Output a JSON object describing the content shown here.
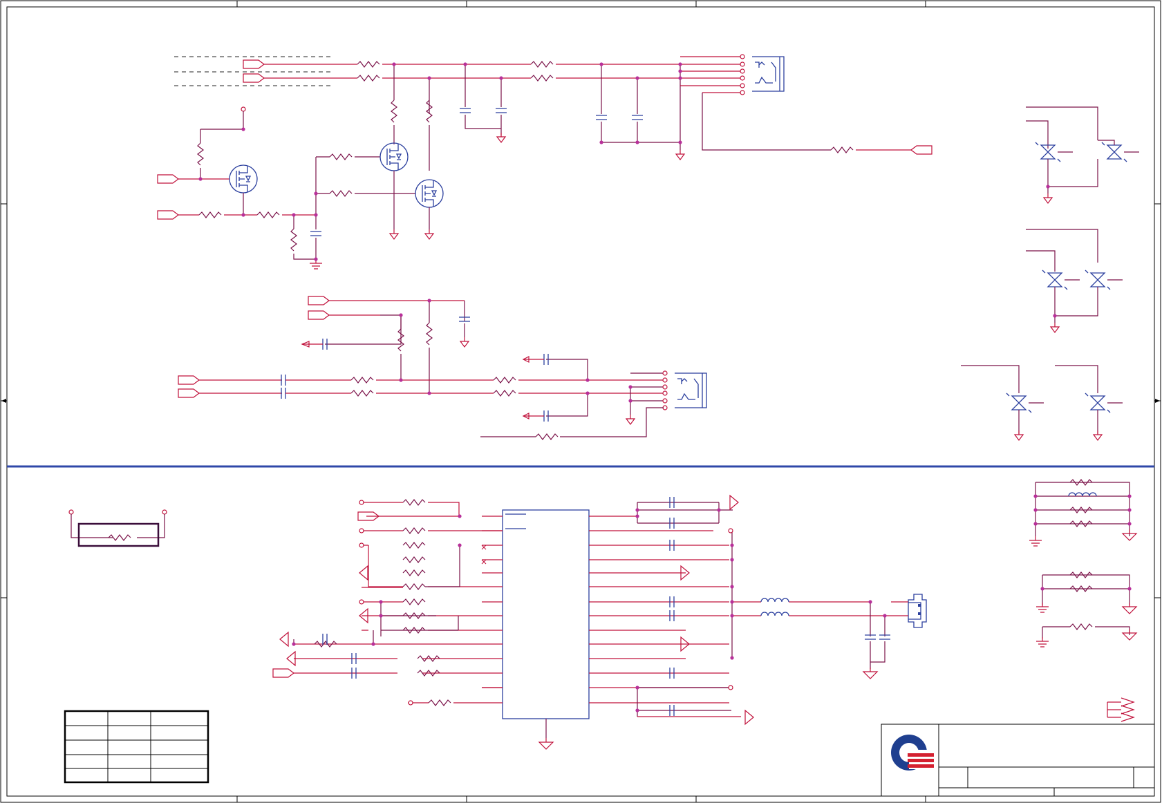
{
  "schematic": {
    "colors": {
      "wire": "#c0103a",
      "net": "#7a1148",
      "component": "#2b3f9e",
      "divider": "#2f47a8",
      "junction": "#b8309a",
      "logo_blue": "#1f3f8f",
      "logo_red": "#d42030"
    },
    "icons": [
      "resistor-icon",
      "capacitor-icon",
      "inductor-icon",
      "mosfet-icon",
      "tvs-diode-icon",
      "ground-icon",
      "port-icon",
      "jack-connector-icon",
      "usb-connector-icon",
      "company-logo-icon"
    ],
    "revision_table": {
      "rows": [
        [
          "",
          "",
          ""
        ],
        [
          "",
          "",
          ""
        ],
        [
          "",
          "",
          ""
        ],
        [
          "",
          "",
          ""
        ],
        [
          "",
          "",
          ""
        ]
      ]
    },
    "title_block": {
      "title": "",
      "size": "",
      "document_number": "",
      "rev": "",
      "date": "",
      "sheet": ""
    }
  }
}
